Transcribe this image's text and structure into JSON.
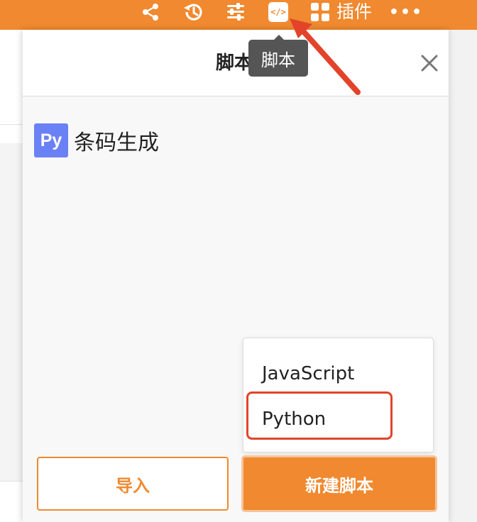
{
  "toolbar": {
    "plugins_label": "插件",
    "more_label": "•••",
    "icons": [
      "share-icon",
      "history-icon",
      "filter-settings-icon",
      "script-icon",
      "plugins-icon",
      "more-icon"
    ]
  },
  "script_badge_label": "</>",
  "tooltip": {
    "text": "脚本"
  },
  "panel": {
    "title": "脚本",
    "scripts": [
      {
        "badge": "Py",
        "name": "条码生成"
      }
    ]
  },
  "dropdown": {
    "options": [
      "JavaScript",
      "Python"
    ],
    "highlighted": "Python"
  },
  "buttons": {
    "import_label": "导入",
    "new_script_label": "新建脚本"
  },
  "colors": {
    "accent": "#f0892f",
    "python_badge": "#6a81f5",
    "annotation_red": "#e2432a",
    "tooltip_bg": "#555555"
  }
}
